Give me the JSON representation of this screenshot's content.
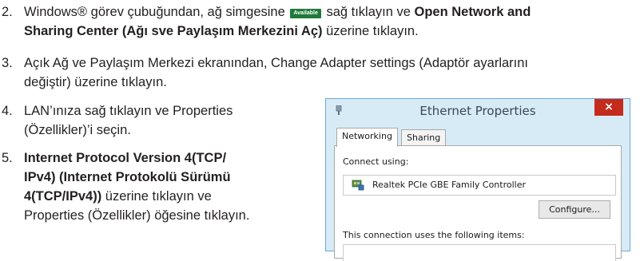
{
  "steps": [
    {
      "number": "2.",
      "pre": "Windows® görev çubuğundan, ağ simgesine",
      "badge": "Available",
      "mid": "sağ tıklayın ve",
      "bold1": "Open Network and",
      "bold2": "Sharing Center (Ağı sve Paylaşım Merkezini Aç)",
      "post": "üzerine tıklayın."
    },
    {
      "number": "3.",
      "line1": "Açık Ağ ve Paylaşım Merkezi ekranından, Change Adapter settings (Adaptör ayarlarını",
      "line2": "değiştir) üzerine tıklayın."
    },
    {
      "number": "4.",
      "line1": "LAN’ınıza sağ tıklayın ve Properties",
      "line2": "(Özellikler)’i seçin."
    },
    {
      "number": "5.",
      "bold1": "Internet Protocol Version 4(TCP/",
      "bold2": "IPv4) (Internet Protokolü Sürümü",
      "bold3": "4(TCP/IPv4))",
      "post3": "üzerine tıklayın ve",
      "line4": "Properties (Özellikler) öğesine tıklayın."
    }
  ],
  "dialog": {
    "title": "Ethernet Properties",
    "close": "×",
    "tabs": [
      "Networking",
      "Sharing"
    ],
    "connect_using_label": "Connect using:",
    "adapter_name": "Realtek PCIe GBE Family Controller",
    "configure_button": "Configure...",
    "items_label": "This connection uses the following items:"
  }
}
